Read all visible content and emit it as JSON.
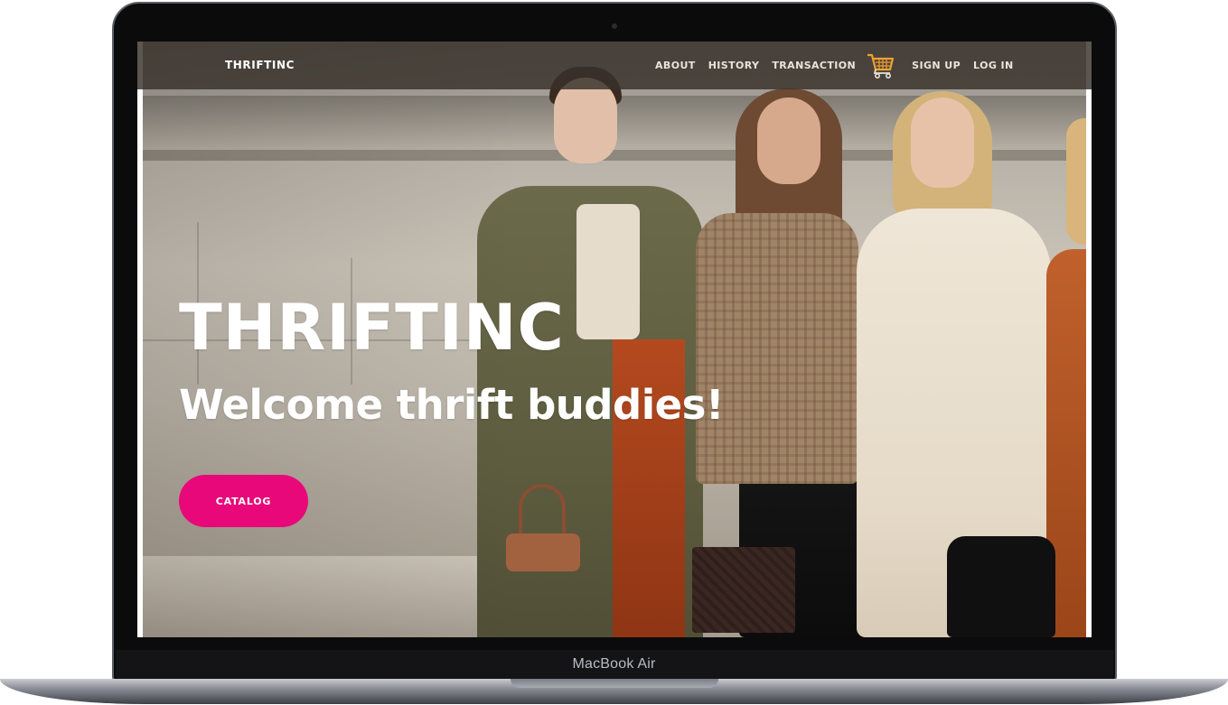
{
  "device": {
    "label": "MacBook Air"
  },
  "navbar": {
    "brand": "THRIFTINC",
    "links": {
      "about": "ABOUT",
      "history": "HISTORY",
      "transaction": "TRANSACTION",
      "signup": "SIGN UP",
      "login": "LOG IN"
    },
    "cart_icon": "shopping-cart-icon"
  },
  "hero": {
    "title": "THRIFTINC",
    "subtitle": "Welcome thrift buddies!",
    "cta_label": "CATALOG",
    "background": "street-fashion-photo"
  },
  "colors": {
    "accent": "#e8087a",
    "cart_icon": "#f0a030",
    "navbar_bg": "#37312a"
  }
}
